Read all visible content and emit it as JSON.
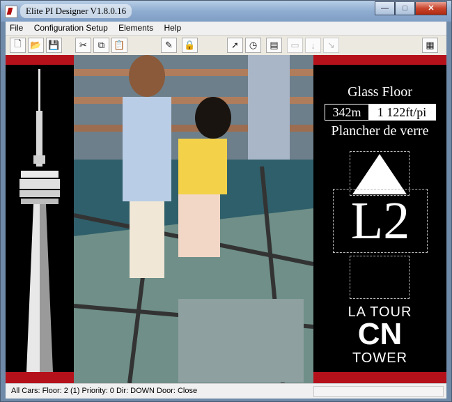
{
  "window": {
    "title": "Elite PI Designer V1.8.0.16",
    "minimize": "—",
    "maximize": "□",
    "close": "✕"
  },
  "menu": [
    "File",
    "Configuration Setup",
    "Elements",
    "Help"
  ],
  "toolbar": {
    "buttons": [
      {
        "name": "new-file-button",
        "icon": "new-file-icon",
        "glyph": "🗋",
        "enabled": true
      },
      {
        "name": "open-folder-button",
        "icon": "folder-icon",
        "glyph": "📂",
        "enabled": true
      },
      {
        "name": "save-button",
        "icon": "floppy-disk-icon",
        "glyph": "💾",
        "enabled": true
      },
      {
        "name": "cut-button",
        "icon": "scissors-icon",
        "glyph": "✂",
        "enabled": true
      },
      {
        "name": "copy-button",
        "icon": "copy-icon",
        "glyph": "⧉",
        "enabled": true
      },
      {
        "name": "paste-button",
        "icon": "paste-icon",
        "glyph": "📋",
        "enabled": true
      },
      {
        "name": "edit-element-button",
        "icon": "edit-pencil-icon",
        "glyph": "✎",
        "enabled": true
      },
      {
        "name": "lock-button",
        "icon": "lock-icon",
        "glyph": "🔒",
        "enabled": true
      },
      {
        "name": "select-pointer-button",
        "icon": "arrow-pointer-icon",
        "glyph": "➚",
        "enabled": true
      },
      {
        "name": "clock-button",
        "icon": "clock-icon",
        "glyph": "◷",
        "enabled": true
      },
      {
        "name": "properties-button",
        "icon": "document-properties-icon",
        "glyph": "▤",
        "enabled": true
      },
      {
        "name": "disabled-tool-1-button",
        "icon": "blank-icon",
        "glyph": "▭",
        "enabled": false
      },
      {
        "name": "disabled-tool-2-button",
        "icon": "arrow-down-icon",
        "glyph": "↓",
        "enabled": false
      },
      {
        "name": "disabled-tool-3-button",
        "icon": "arrow-curve-icon",
        "glyph": "↘",
        "enabled": false
      },
      {
        "name": "layout-view-button",
        "icon": "window-layout-icon",
        "glyph": "▦",
        "enabled": true
      }
    ]
  },
  "display": {
    "floor_name_en": "Glass Floor",
    "height_m": "342m",
    "height_ft": "1 122ft/pi",
    "floor_name_fr": "Plancher de verre",
    "floor_label": "L2",
    "brand_line1": "LA TOUR",
    "brand_logo": "CN",
    "brand_line2": "TOWER",
    "accent_red": "#b5111b"
  },
  "status": {
    "text": "All Cars:  Floor:    2 (1) Priority: 0 Dir: DOWN  Door:  Close"
  }
}
